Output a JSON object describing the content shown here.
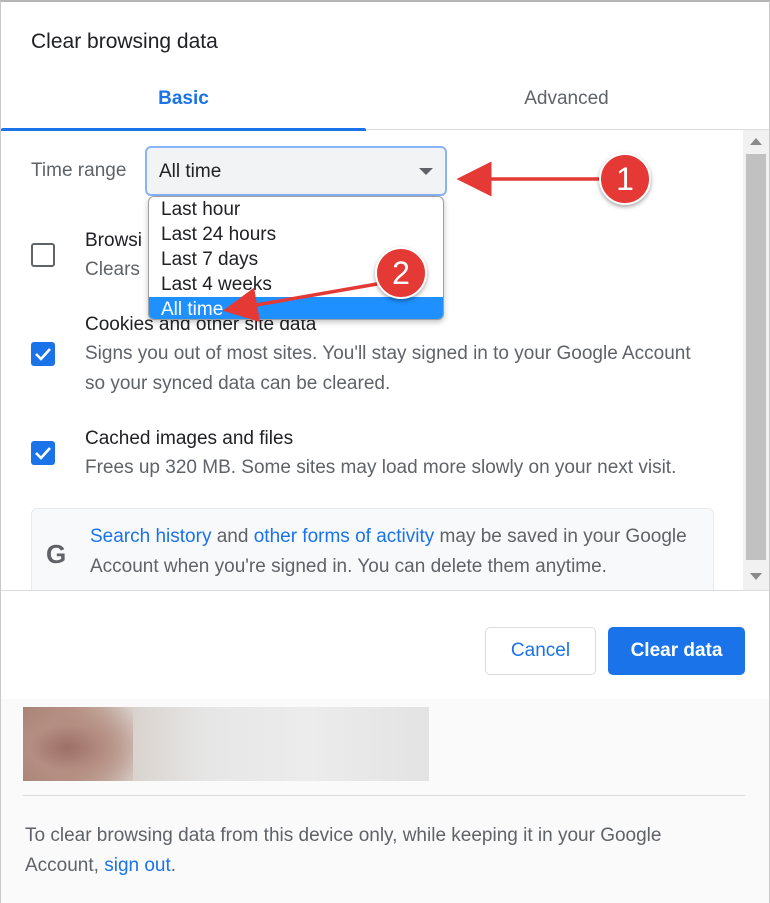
{
  "dialog": {
    "title": "Clear browsing data"
  },
  "tabs": [
    {
      "label": "Basic",
      "active": true
    },
    {
      "label": "Advanced",
      "active": false
    }
  ],
  "time_range": {
    "label": "Time range",
    "value": "All time",
    "options": [
      "Last hour",
      "Last 24 hours",
      "Last 7 days",
      "Last 4 weeks",
      "All time"
    ],
    "selected_index": 4
  },
  "items": [
    {
      "title": "Browsi",
      "desc": "Clears ",
      "checked": false
    },
    {
      "title": "Cookies and other site data",
      "desc_line1": "Signs you out of most sites. You'll stay signed in to your Google Account",
      "desc_line2": "so your synced data can be cleared.",
      "checked": true
    },
    {
      "title": "Cached images and files",
      "desc": "Frees up 320 MB. Some sites may load more slowly on your next visit.",
      "checked": true
    }
  ],
  "info": {
    "icon": "G",
    "link1": "Search history",
    "text1": " and ",
    "link2": "other forms of activity",
    "text2": " may be saved in your Google Account when you're signed in. You can delete them anytime."
  },
  "buttons": {
    "cancel": "Cancel",
    "clear": "Clear data"
  },
  "footer": {
    "text": "To clear browsing data from this device only, while keeping it in your Google Account, ",
    "link": "sign out",
    "end": "."
  },
  "annotations": {
    "badge1": "1",
    "badge2": "2"
  },
  "colors": {
    "accent": "#1a73e8",
    "annotation": "#e53935",
    "dropdown_selected": "#1e90ff"
  }
}
